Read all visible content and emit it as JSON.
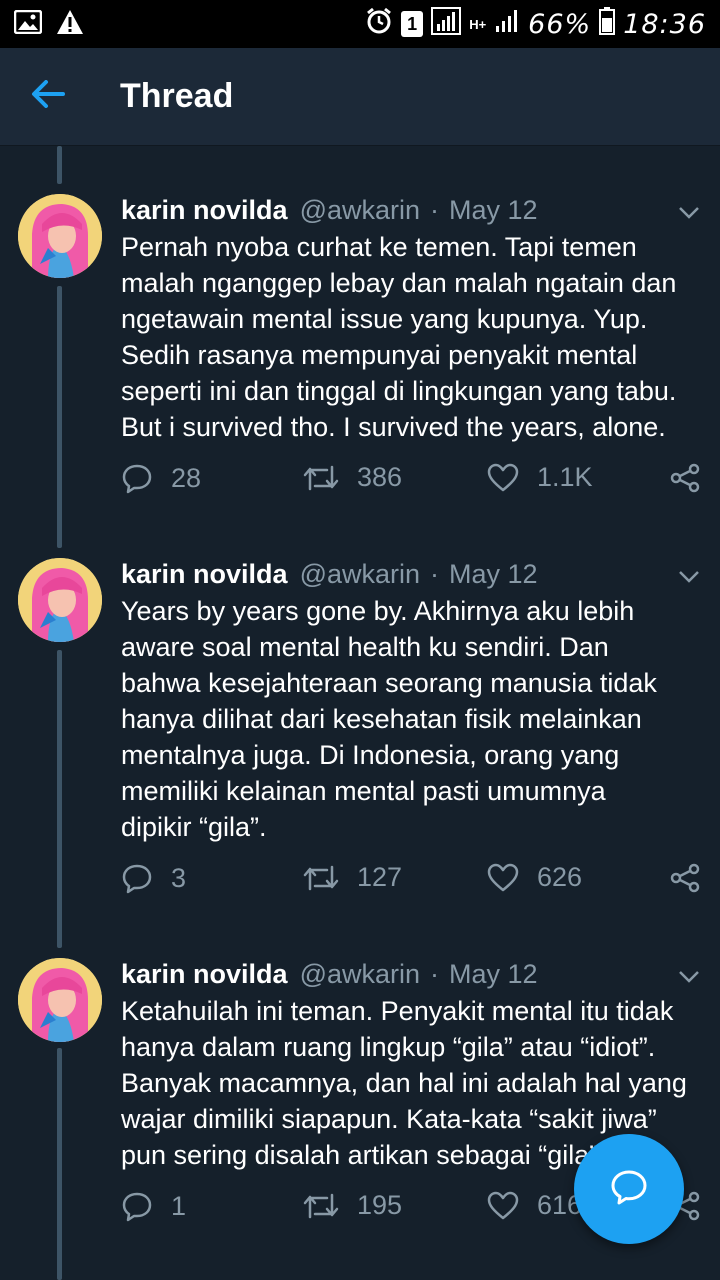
{
  "status_bar": {
    "sim_badge": "1",
    "network_type": "H+",
    "battery": "66%",
    "time": "18:36"
  },
  "header": {
    "title": "Thread"
  },
  "tweets": [
    {
      "name": "karin novilda",
      "handle": "@awkarin",
      "separator": "·",
      "date": "May 12",
      "lines": [
        "Pernah nyoba curhat ke temen. Tapi temen",
        "malah nganggep lebay dan malah ngatain dan",
        "ngetawain mental issue yang kupunya. Yup.",
        "Sedih rasanya mempunyai penyakit mental",
        "seperti ini dan tinggal di lingkungan yang tabu.",
        "But i survived tho. I survived the years, alone."
      ],
      "replies": "28",
      "retweets": "386",
      "likes": "1.1K"
    },
    {
      "name": "karin novilda",
      "handle": "@awkarin",
      "separator": "·",
      "date": "May 12",
      "lines": [
        "Years by years gone by. Akhirnya aku lebih",
        "aware soal mental health ku sendiri. Dan",
        "bahwa kesejahteraan seorang manusia tidak",
        "hanya dilihat dari kesehatan fisik melainkan",
        "mentalnya juga. Di Indonesia, orang yang",
        "memiliki kelainan mental pasti umumnya",
        "dipikir “gila”."
      ],
      "replies": "3",
      "retweets": "127",
      "likes": "626"
    },
    {
      "name": "karin novilda",
      "handle": "@awkarin",
      "separator": "·",
      "date": "May 12",
      "lines": [
        "Ketahuilah ini teman. Penyakit mental itu tidak",
        "hanya dalam ruang lingkup “gila” atau “idiot”.",
        "Banyak macamnya, dan hal ini adalah hal yang",
        "wajar dimiliki siapapun. Kata-kata “sakit jiwa”",
        "pun sering disalah artikan sebagai “gila”."
      ],
      "replies": "1",
      "retweets": "195",
      "likes": "616"
    }
  ],
  "colors": {
    "background": "#15202b",
    "header_bg": "#1c2938",
    "accent": "#1da1f2",
    "muted": "#8899a6",
    "thread_line": "#3d5466"
  },
  "icons": {
    "back": "arrow-left-icon",
    "caret": "chevron-down-icon",
    "reply": "reply-bubble-icon",
    "retweet": "retweet-icon",
    "like": "heart-icon",
    "share": "share-icon",
    "fab": "compose-reply-icon"
  }
}
